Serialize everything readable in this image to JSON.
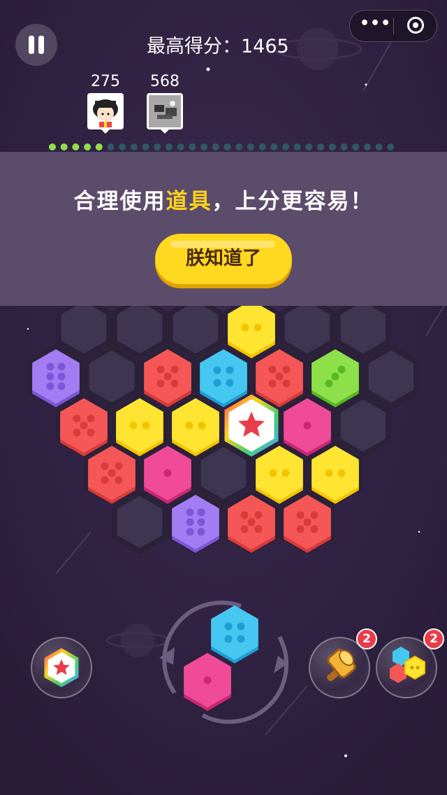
{
  "header": {
    "best_score_text": "最高得分：1465",
    "capsule_more_icon": "more-dots-icon",
    "capsule_close_icon": "mini-program-close-icon"
  },
  "friends": [
    {
      "score": "275",
      "avatar": "cartoon-girl-avatar"
    },
    {
      "score": "568",
      "avatar": "grey-photo-avatar"
    }
  ],
  "progress": {
    "total": 30,
    "filled": 5,
    "filled_color": "#8ee04a",
    "empty_color": "#2f5a63"
  },
  "tutorial": {
    "text_before": "合理使用",
    "text_highlight": "道具",
    "text_after": "，上分更容易！",
    "button_label": "朕知道了"
  },
  "board": {
    "rows": [
      [
        {
          "c": "empty"
        },
        {
          "c": "empty"
        },
        {
          "c": "empty"
        },
        {
          "c": "yellow",
          "d": 2
        },
        {
          "c": "empty"
        },
        {
          "c": "empty"
        }
      ],
      [
        {
          "c": "purple",
          "d": 6
        },
        {
          "c": "empty"
        },
        {
          "c": "red",
          "d": 5
        },
        {
          "c": "blue",
          "d": 4
        },
        {
          "c": "red",
          "d": 5
        },
        {
          "c": "green",
          "d": 3
        },
        {
          "c": "empty"
        }
      ],
      [
        {
          "c": "red",
          "d": 5
        },
        {
          "c": "yellow",
          "d": 2
        },
        {
          "c": "yellow",
          "d": 2
        },
        {
          "c": "star"
        },
        {
          "c": "pink",
          "d": 1
        },
        {
          "c": "empty"
        }
      ],
      [
        {
          "c": "red",
          "d": 5
        },
        {
          "c": "pink",
          "d": 1
        },
        {
          "c": "empty"
        },
        {
          "c": "yellow",
          "d": 2
        },
        {
          "c": "yellow",
          "d": 2
        }
      ],
      [
        {
          "c": "empty"
        },
        {
          "c": "purple",
          "d": 6
        },
        {
          "c": "red",
          "d": 5
        },
        {
          "c": "red",
          "d": 5
        }
      ]
    ]
  },
  "next_piece": [
    {
      "c": "blue",
      "d": 4
    },
    {
      "c": "pink",
      "d": 1
    }
  ],
  "tools": {
    "star_tool": {
      "icon": "rainbow-star-hexagon-icon"
    },
    "hammer_tool": {
      "icon": "hammer-icon",
      "count": "2"
    },
    "refresh_tool": {
      "icon": "hexagon-shuffle-icon",
      "count": "2"
    },
    "rotate_icon": "rotate-arrows-icon"
  },
  "colors": {
    "yellow": [
      "#ffe531",
      "#f4c400"
    ],
    "red": [
      "#f55757",
      "#d93a3a"
    ],
    "blue": [
      "#45c7f2",
      "#1e9fd3"
    ],
    "green": [
      "#8ee04a",
      "#57b821"
    ],
    "purple": [
      "#a27cf2",
      "#7c55d9"
    ],
    "pink": [
      "#f04b98",
      "#cc2773"
    ],
    "empty": [
      "#3e3552",
      "#342b45"
    ]
  }
}
